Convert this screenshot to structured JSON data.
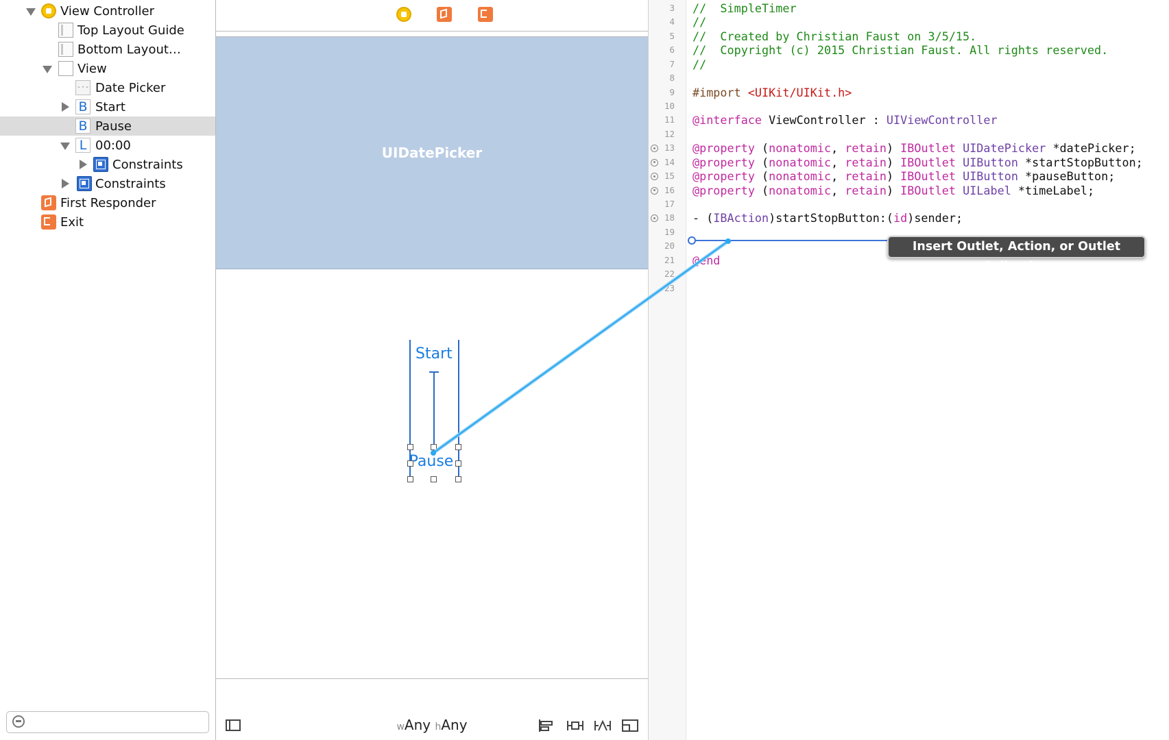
{
  "outline": {
    "items": [
      {
        "label": "View Controller",
        "icon": "view-controller-icon"
      },
      {
        "label": "Top Layout Guide",
        "icon": "layout-guide-icon"
      },
      {
        "label": "Bottom Layout…",
        "icon": "layout-guide-icon"
      },
      {
        "label": "View",
        "icon": "view-icon"
      },
      {
        "label": "Date Picker",
        "icon": "date-picker-icon"
      },
      {
        "label": "Start",
        "icon": "button-icon",
        "icon_letter": "B"
      },
      {
        "label": "Pause",
        "icon": "button-icon",
        "icon_letter": "B",
        "selected": true
      },
      {
        "label": "00:00",
        "icon": "label-icon",
        "icon_letter": "L"
      },
      {
        "label": "Constraints",
        "icon": "constraints-icon"
      },
      {
        "label": "Constraints",
        "icon": "constraints-icon"
      },
      {
        "label": "First Responder",
        "icon": "first-responder-icon"
      },
      {
        "label": "Exit",
        "icon": "exit-icon"
      }
    ],
    "filter_placeholder": ""
  },
  "canvas": {
    "top_icons": [
      "view-controller-icon",
      "first-responder-icon",
      "exit-icon"
    ],
    "date_picker_label": "UIDatePicker",
    "start_button": "Start",
    "pause_button": "Pause",
    "size_class": {
      "w_prefix": "w",
      "w_value": "Any",
      "h_prefix": "h",
      "h_value": "Any"
    },
    "bottom_icons": [
      "align-icon",
      "pin-icon",
      "resolve-icon",
      "resizing-icon"
    ]
  },
  "editor": {
    "lines": [
      {
        "n": "3",
        "parts": [
          {
            "c": "c",
            "t": "//  SimpleTimer"
          }
        ]
      },
      {
        "n": "4",
        "parts": [
          {
            "c": "c",
            "t": "//"
          }
        ]
      },
      {
        "n": "5",
        "parts": [
          {
            "c": "c",
            "t": "//  Created by Christian Faust on 3/5/15."
          }
        ]
      },
      {
        "n": "6",
        "parts": [
          {
            "c": "c",
            "t": "//  Copyright (c) 2015 Christian Faust. All rights reserved."
          }
        ]
      },
      {
        "n": "7",
        "parts": [
          {
            "c": "c",
            "t": "//"
          }
        ]
      },
      {
        "n": "8",
        "parts": []
      },
      {
        "n": "9",
        "parts": [
          {
            "c": "m",
            "t": "#import "
          },
          {
            "c": "s",
            "t": "<UIKit/UIKit.h>"
          }
        ]
      },
      {
        "n": "10",
        "parts": []
      },
      {
        "n": "11",
        "parts": [
          {
            "c": "k",
            "t": "@interface"
          },
          {
            "c": "p",
            "t": " ViewController : "
          },
          {
            "c": "t",
            "t": "UIViewController"
          }
        ]
      },
      {
        "n": "12",
        "parts": []
      },
      {
        "n": "13",
        "outlet": true,
        "parts": [
          {
            "c": "k",
            "t": "@property"
          },
          {
            "c": "p",
            "t": " ("
          },
          {
            "c": "k",
            "t": "nonatomic"
          },
          {
            "c": "p",
            "t": ", "
          },
          {
            "c": "k",
            "t": "retain"
          },
          {
            "c": "p",
            "t": ") "
          },
          {
            "c": "k",
            "t": "IBOutlet"
          },
          {
            "c": "p",
            "t": " "
          },
          {
            "c": "t",
            "t": "UIDatePicker"
          },
          {
            "c": "p",
            "t": " *datePicker;"
          }
        ]
      },
      {
        "n": "14",
        "outlet": true,
        "parts": [
          {
            "c": "k",
            "t": "@property"
          },
          {
            "c": "p",
            "t": " ("
          },
          {
            "c": "k",
            "t": "nonatomic"
          },
          {
            "c": "p",
            "t": ", "
          },
          {
            "c": "k",
            "t": "retain"
          },
          {
            "c": "p",
            "t": ") "
          },
          {
            "c": "k",
            "t": "IBOutlet"
          },
          {
            "c": "p",
            "t": " "
          },
          {
            "c": "t",
            "t": "UIButton"
          },
          {
            "c": "p",
            "t": " *startStopButton;"
          }
        ]
      },
      {
        "n": "15",
        "outlet": true,
        "parts": [
          {
            "c": "k",
            "t": "@property"
          },
          {
            "c": "p",
            "t": " ("
          },
          {
            "c": "k",
            "t": "nonatomic"
          },
          {
            "c": "p",
            "t": ", "
          },
          {
            "c": "k",
            "t": "retain"
          },
          {
            "c": "p",
            "t": ") "
          },
          {
            "c": "k",
            "t": "IBOutlet"
          },
          {
            "c": "p",
            "t": " "
          },
          {
            "c": "t",
            "t": "UIButton"
          },
          {
            "c": "p",
            "t": " *pauseButton;"
          }
        ]
      },
      {
        "n": "16",
        "outlet": true,
        "parts": [
          {
            "c": "k",
            "t": "@property"
          },
          {
            "c": "p",
            "t": " ("
          },
          {
            "c": "k",
            "t": "nonatomic"
          },
          {
            "c": "p",
            "t": ", "
          },
          {
            "c": "k",
            "t": "retain"
          },
          {
            "c": "p",
            "t": ") "
          },
          {
            "c": "k",
            "t": "IBOutlet"
          },
          {
            "c": "p",
            "t": " "
          },
          {
            "c": "t",
            "t": "UILabel"
          },
          {
            "c": "p",
            "t": " *timeLabel;"
          }
        ]
      },
      {
        "n": "17",
        "parts": []
      },
      {
        "n": "18",
        "outlet": true,
        "parts": [
          {
            "c": "p",
            "t": "- ("
          },
          {
            "c": "t",
            "t": "IBAction"
          },
          {
            "c": "p",
            "t": ")startStopButton:("
          },
          {
            "c": "k",
            "t": "id"
          },
          {
            "c": "p",
            "t": ")sender;"
          }
        ]
      },
      {
        "n": "19",
        "parts": []
      },
      {
        "n": "20",
        "parts": []
      },
      {
        "n": "21",
        "parts": [
          {
            "c": "k",
            "t": "@end"
          }
        ]
      },
      {
        "n": "22",
        "parts": []
      },
      {
        "n": "23",
        "parts": []
      }
    ],
    "tooltip": "Insert Outlet, Action, or Outlet Collection"
  },
  "colors": {
    "accent": "#1a7ee0",
    "date_picker_bg": "#b8cce4",
    "connection_line": "#2ba8f0",
    "insert_line": "#3c73d8",
    "selection": "#dcdcdc"
  }
}
